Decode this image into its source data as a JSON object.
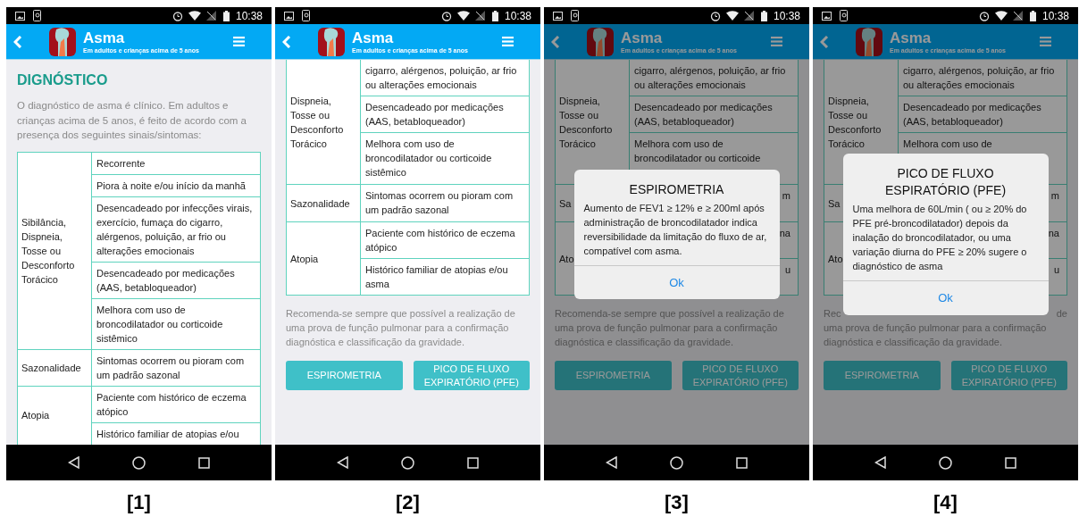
{
  "screens": [
    {
      "label": "[1]",
      "kind": "top",
      "status_bar": {
        "time": "10:38"
      },
      "app_bar": {
        "title": "Asma",
        "subtitle": "Em adultos e crianças acima de 5 anos"
      },
      "heading": "DIGNÓSTICO",
      "intro": "O diagnóstico de asma é clínico. Em adultos e crianças acima de 5 anos, é feito de acordo com a presença dos seguintes sinais/sintomas:",
      "table": [
        {
          "label": "Sibilância, Dispneia, Tosse ou Desconforto Torácico",
          "items": [
            "Recorrente",
            "Piora à noite e/ou início da manhã",
            "Desencadeado por infecções virais, exercício, fumaça do cigarro, alérgenos, poluição, ar frio ou alterações emocionais",
            "Desencadeado por medicações (AAS, betabloqueador)",
            "Melhora com uso de broncodilatador ou corticoide sistêmico"
          ]
        },
        {
          "label": "Sazonalidade",
          "items": [
            "Sintomas ocorrem ou pioram com um padrão sazonal"
          ]
        },
        {
          "label": "Atopia",
          "items": [
            "Paciente com histórico de eczema atópico",
            "Histórico familiar de atopias e/ou"
          ]
        }
      ]
    },
    {
      "label": "[2]",
      "kind": "scrolled",
      "status_bar": {
        "time": "10:38"
      },
      "app_bar": {
        "title": "Asma",
        "subtitle": "Em adultos e crianças acima de 5 anos"
      },
      "table": [
        {
          "label": "Dispneia, Tosse ou Desconforto Torácico",
          "items": [
            "cigarro, alérgenos, poluição, ar frio ou alterações emocionais",
            "Desencadeado por medicações (AAS, betabloqueador)",
            "Melhora com uso de broncodilatador ou corticoide sistêmico"
          ]
        },
        {
          "label": "Sazonalidade",
          "items": [
            "Sintomas ocorrem ou pioram com um padrão sazonal"
          ]
        },
        {
          "label": "Atopia",
          "items": [
            "Paciente com histórico de eczema atópico",
            "Histórico familiar de atopias e/ou asma"
          ]
        }
      ],
      "footnote": {
        "text": "Recomenda-se sempre que possível a realização de uma prova de função pulmonar para a confirmação diagnóstica e classificação da gravidade."
      },
      "buttons": [
        "ESPIROMETRIA",
        "PICO DE FLUXO EXPIRATÓRIO (PFE)"
      ]
    },
    {
      "label": "[3]",
      "kind": "scrolled",
      "status_bar": {
        "time": "10:38"
      },
      "app_bar": {
        "title": "Asma",
        "subtitle": "Em adultos e crianças acima de 5 anos"
      },
      "table": [
        {
          "label": "Dispneia, Tosse ou Desconforto Torácico",
          "items": [
            "cigarro, alérgenos, poluição, ar frio ou alterações emocionais",
            "Desencadeado por medicações (AAS, betabloqueador)",
            "Melhora com uso de broncodilatador ou corticoide"
          ]
        },
        {
          "label": "Sa",
          "items": [
            "m"
          ],
          "items_show_right_edge_only": true
        },
        {
          "label": "Ato",
          "items": [
            "na",
            "u"
          ],
          "items_show_right_edge_only": true
        }
      ],
      "footnote": {
        "text": "Recomenda-se sempre que possível a realização de uma prova de função pulmonar para a confirmação diagnóstica e classificação da gravidade."
      },
      "buttons": [
        "ESPIROMETRIA",
        "PICO DE FLUXO EXPIRATÓRIO (PFE)"
      ],
      "dialog": {
        "title": "ESPIROMETRIA",
        "body": "Aumento de FEV1 ≥ 12% e ≥ 200ml após administração de broncodilatador indica reversibilidade da limitação do fluxo de ar, compatível com asma.",
        "button": "Ok"
      }
    },
    {
      "label": "[4]",
      "kind": "scrolled",
      "status_bar": {
        "time": "10:38"
      },
      "app_bar": {
        "title": "Asma",
        "subtitle": "Em adultos e crianças acima de 5 anos"
      },
      "table": [
        {
          "label": "Dispneia, Tosse ou Desconforto Torácico",
          "items": [
            "cigarro, alérgenos, poluição, ar frio ou alterações emocionais",
            "Desencadeado por medicações (AAS, betabloqueador)",
            "Melhora com uso de"
          ]
        },
        {
          "label": "Sa",
          "items": [
            "m"
          ],
          "items_show_right_edge_only": true
        },
        {
          "label": "Ato",
          "items": [
            "na",
            "u"
          ],
          "items_show_right_edge_only": true
        }
      ],
      "footnote": {
        "first_line_start": "Rec",
        "first_line_end": "de",
        "text": "uma prova de função pulmonar para a confirmação diagnóstica e classificação da gravidade."
      },
      "buttons": [
        "ESPIROMETRIA",
        "PICO DE FLUXO EXPIRATÓRIO (PFE)"
      ],
      "dialog": {
        "title": "PICO DE FLUXO ESPIRATÓRIO (PFE)",
        "body": "Uma melhora de 60L/min ( ou ≥ 20% do PFE pré-broncodilatador) depois da inalação do broncodilatador, ou uma variação diurna do PFE ≥ 20% sugere o diagnóstico de asma",
        "button": "Ok"
      }
    }
  ]
}
